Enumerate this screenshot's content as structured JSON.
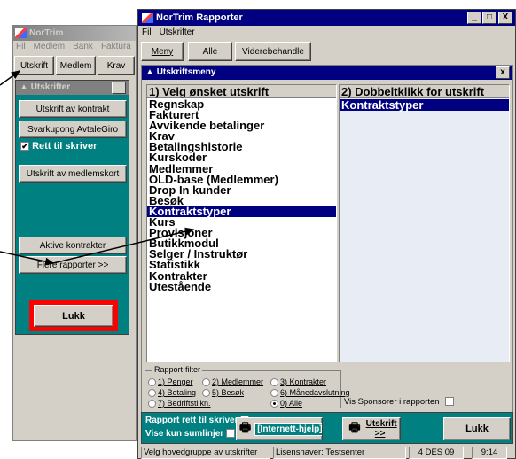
{
  "bg_window": {
    "title": "NorTrim",
    "menu": [
      "Fil",
      "Medlem",
      "Bank",
      "Faktura"
    ],
    "toolbar": [
      "Utskrift",
      "Medlem",
      "Krav"
    ]
  },
  "utskrifter_panel": {
    "title": "Utskrifter",
    "close": "x",
    "buttons": [
      "Utskrift av kontrakt",
      "Svarkupong AvtaleGiro"
    ],
    "rett_til_skriver": "Rett til skriver",
    "btn_medlemskort": "Utskrift av medlemskort",
    "btn_aktive": "Aktive kontrakter",
    "btn_flere": "Flere rapporter >>",
    "btn_lukk": "Lukk"
  },
  "main_window": {
    "title": "NorTrim Rapporter",
    "controls": [
      "_",
      "□",
      "X"
    ],
    "menu": [
      "Fil",
      "Utskrifter"
    ],
    "toolbar": [
      "Meny",
      "Alle",
      "Viderebehandle"
    ]
  },
  "utskriftsmeny": {
    "title": "Utskriftsmeny",
    "close": "x",
    "left_header": "1) Velg ønsket utskrift",
    "left_items": [
      "Regnskap",
      "Fakturert",
      "Avvikende betalinger",
      "Krav",
      "Betalingshistorie",
      "Kurskoder",
      "Medlemmer",
      "OLD-base (Medlemmer)",
      "Drop In kunder",
      "Besøk",
      "Kontraktstyper",
      "Kurs",
      "Provisjoner",
      "Butikkmodul",
      "Selger / Instruktør",
      "Statistikk",
      "Kontrakter",
      "Utestående"
    ],
    "selected_index": 10,
    "right_header": "2) Dobbeltklikk for utskrift",
    "right_items": [
      "Kontraktstyper"
    ]
  },
  "rapport_filter": {
    "label": "Rapport-filter",
    "options": [
      "1) Penger",
      "2) Medlemmer",
      "3) Kontrakter",
      "4) Betaling",
      "5) Besøk",
      "6) Månedavslutning",
      "7) Bedriftstilkn.",
      "0) Alle"
    ],
    "selected": "0) Alle",
    "vis_sponsorer": "Vis Sponsorer i rapporten"
  },
  "bottom": {
    "rapport_rett": "Rapport rett til skriver",
    "vise_kun": "Vise kun sumlinjer",
    "internett": "[Internett-hjelp]",
    "utskrift": "Utskrift >>",
    "lukk": "Lukk"
  },
  "statusbar": [
    "Velg hovedgruppe av utskrifter",
    "Lisenshaver: Testsenter",
    "4 DES 09",
    "9:14"
  ],
  "colors": {
    "teal": "#008080",
    "navy": "#000080",
    "red": "#ff0000",
    "face": "#d4d0c8"
  }
}
